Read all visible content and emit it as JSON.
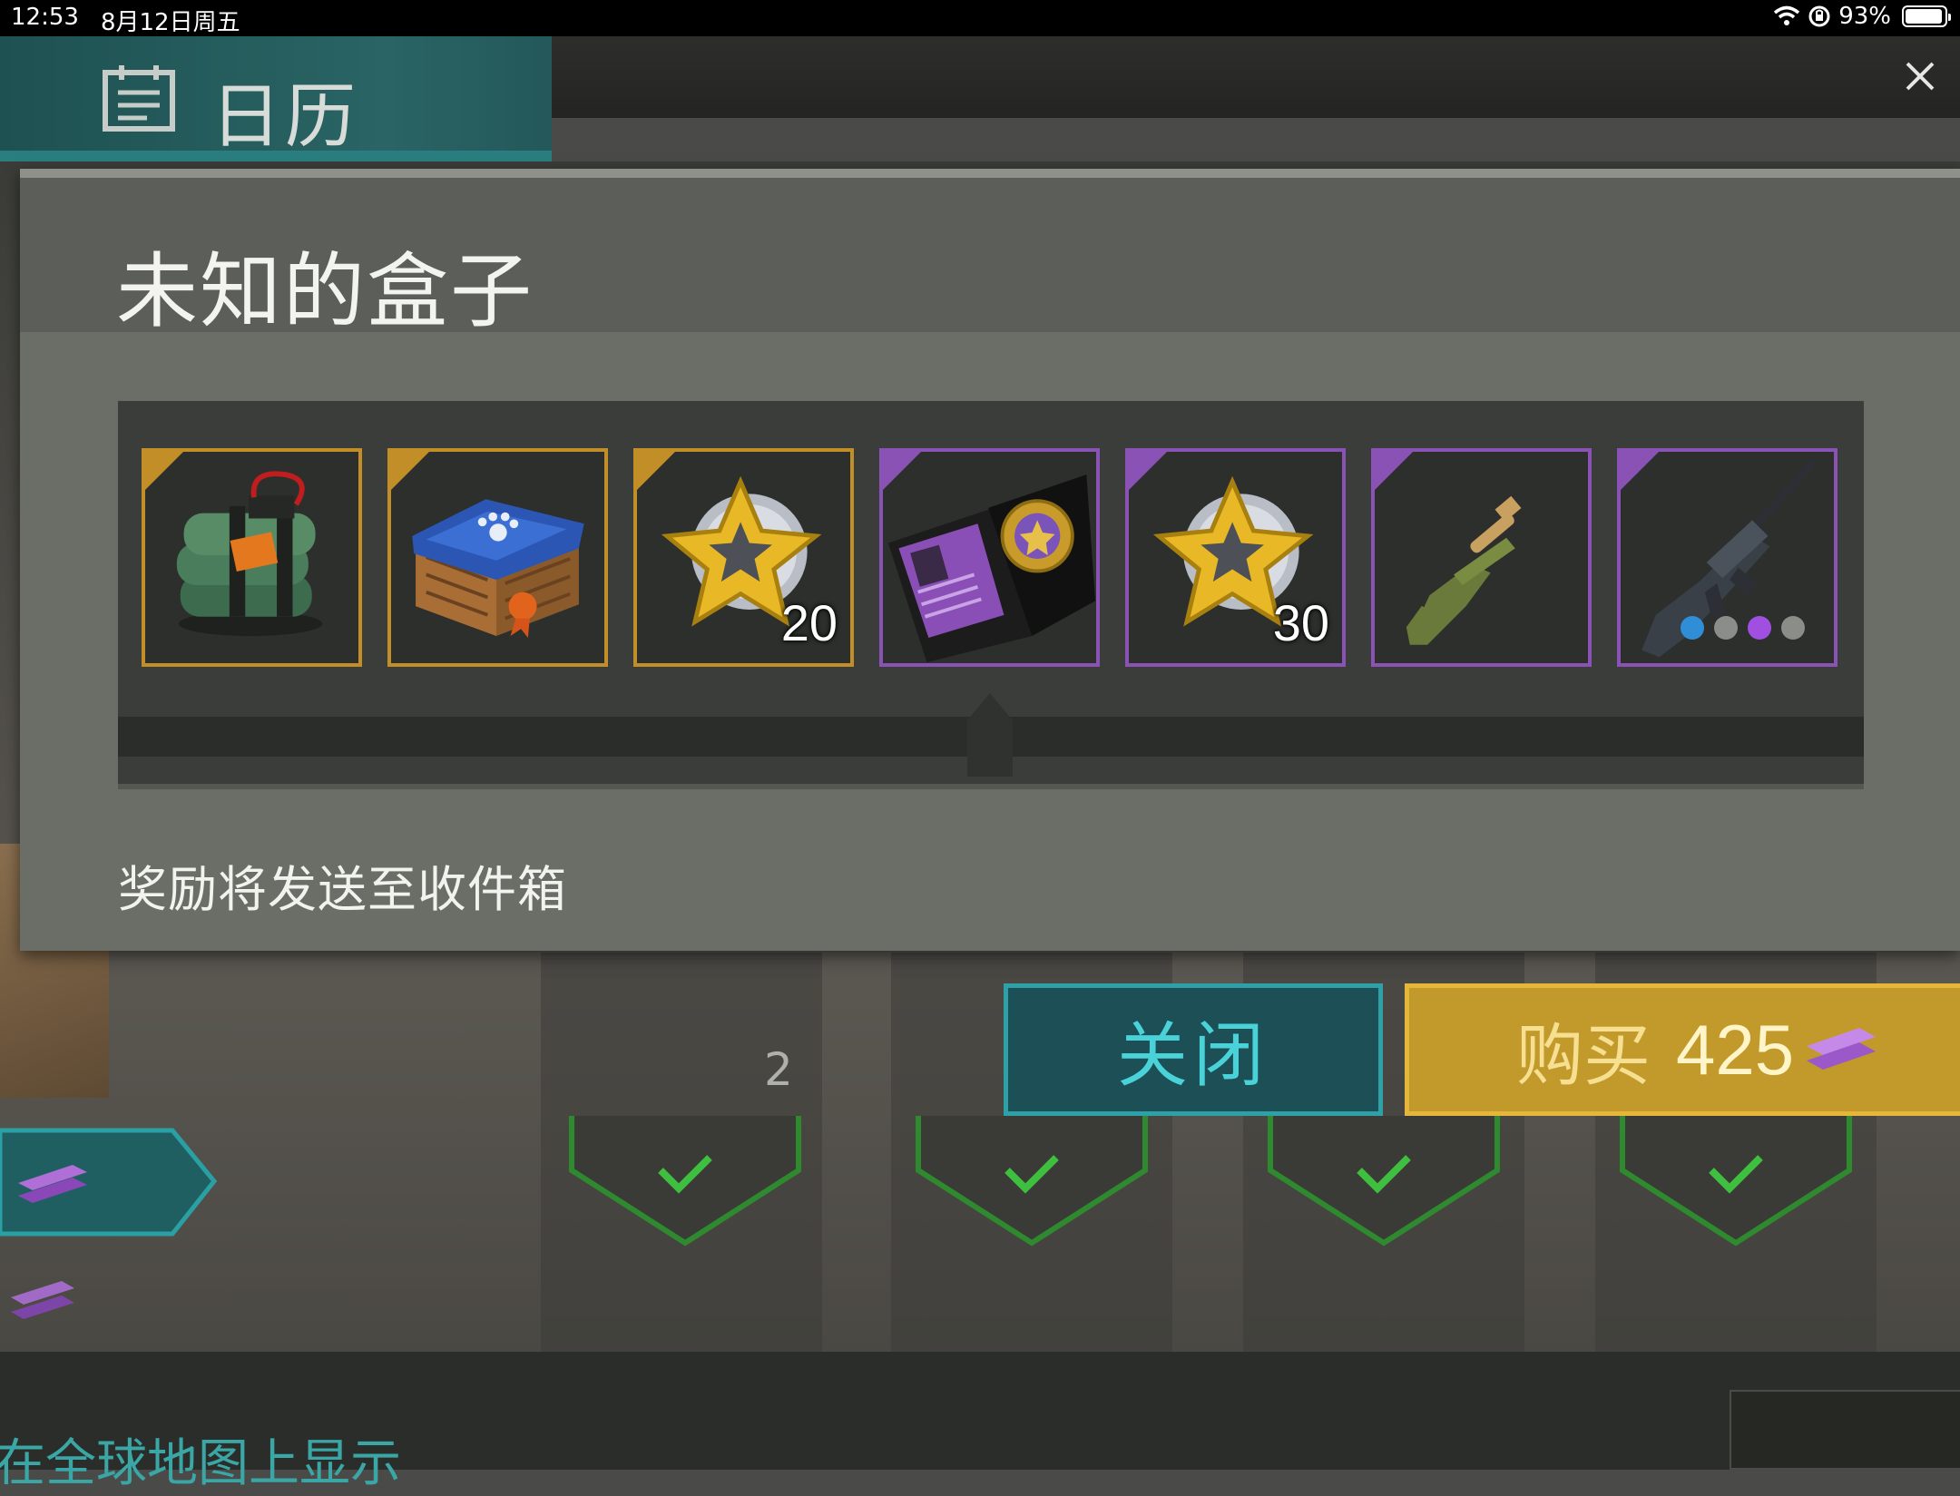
{
  "status_bar": {
    "time": "12:53",
    "date": "8月12日周五",
    "battery_text": "93%",
    "battery_level": 0.93
  },
  "header": {
    "tab_title": "日历",
    "tab_icon": "calendar-icon",
    "close_icon": "close-icon"
  },
  "dialog": {
    "title": "未知的盒子",
    "note": "奖励将发送至收件箱",
    "rarity_colors": {
      "legendary": "#c28e27",
      "epic": "#8a52b5"
    },
    "items": [
      {
        "name": "explosive-pack",
        "rarity": "legendary",
        "quantity": ""
      },
      {
        "name": "pet-crate",
        "rarity": "legendary",
        "quantity": ""
      },
      {
        "name": "star-badge",
        "rarity": "legendary",
        "quantity": "20"
      },
      {
        "name": "police-id-badge",
        "rarity": "epic",
        "quantity": ""
      },
      {
        "name": "star-badge",
        "rarity": "epic",
        "quantity": "30"
      },
      {
        "name": "sniper-rifle",
        "rarity": "epic",
        "quantity": ""
      },
      {
        "name": "assault-rifle",
        "rarity": "epic",
        "quantity": "",
        "dots": [
          "#2f8ed6",
          "#8b8d88",
          "#a14fe0",
          "#8b8d88"
        ]
      }
    ]
  },
  "buttons": {
    "close_label": "关闭",
    "buy_label": "购买",
    "buy_price": "425",
    "currency_icon": "ingot-icon"
  },
  "background": {
    "slot_count": "2",
    "bottom_text": "在全球地图上显示"
  }
}
